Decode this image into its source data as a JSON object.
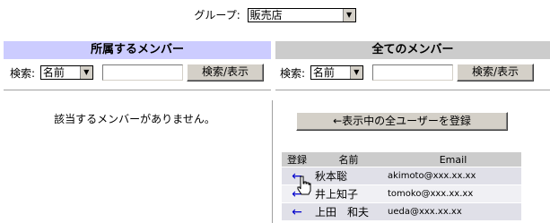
{
  "group": {
    "label": "グループ:",
    "selected": "販売店"
  },
  "left_panel": {
    "title": "所属するメンバー",
    "search_label": "検索:",
    "search_field": "名前",
    "search_value": "",
    "search_button": "検索/表示",
    "empty_message": "該当するメンバーがありません。"
  },
  "right_panel": {
    "title": "全てのメンバー",
    "search_label": "検索:",
    "search_field": "名前",
    "search_value": "",
    "search_button": "検索/表示",
    "register_all_button": "←表示中の全ユーザーを登録",
    "table": {
      "headers": [
        "登録",
        "名前",
        "Email"
      ],
      "rows": [
        {
          "register": "←",
          "name": "秋本聡",
          "email": "akimoto@xxx.xx.xx"
        },
        {
          "register": "←",
          "name": "井上知子",
          "email": "tomoko@xxx.xx.xx"
        },
        {
          "register": "←",
          "name": "上田　和夫",
          "email": "ueda@xxx.xx.xx"
        }
      ]
    }
  },
  "colors": {
    "my_members_header": "#ccccff",
    "all_members_header": "#cccccc",
    "register_arrow": "#0000cc"
  },
  "icons": {
    "dropdown": "chevron-down-icon",
    "cursor": "hand-pointer-icon"
  }
}
